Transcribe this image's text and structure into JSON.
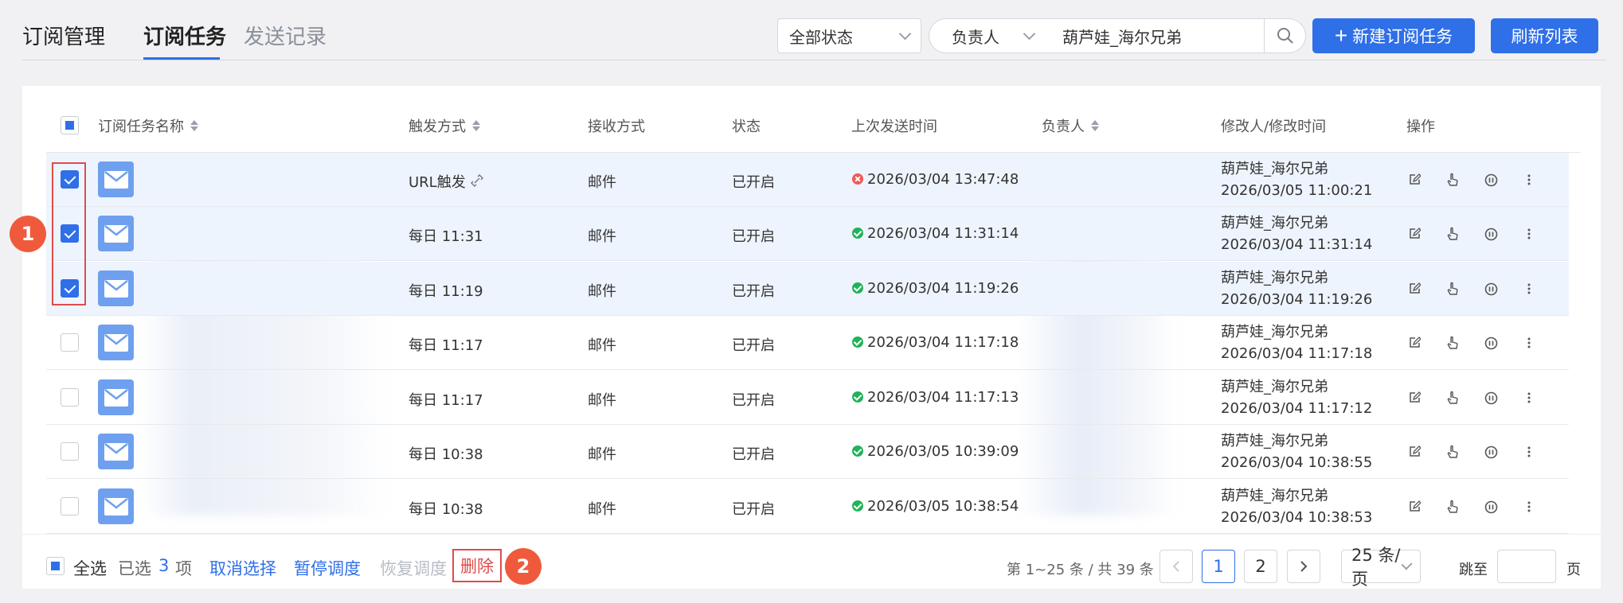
{
  "header": {
    "page_title": "订阅管理",
    "tabs": [
      {
        "label": "订阅任务",
        "active": true
      },
      {
        "label": "发送记录",
        "active": false
      }
    ],
    "status_filter": "全部状态",
    "owner_filter_label": "负责人",
    "owner_filter_value": "葫芦娃_海尔兄弟",
    "new_button": "新建订阅任务",
    "refresh_button": "刷新列表"
  },
  "table": {
    "columns": [
      "订阅任务名称",
      "触发方式",
      "接收方式",
      "状态",
      "上次发送时间",
      "负责人",
      "修改人/修改时间",
      "操作"
    ],
    "rows": [
      {
        "checked": true,
        "trigger": "URL触发",
        "trigger_link": true,
        "receive": "邮件",
        "status": "已开启",
        "last_status": "error",
        "last_sent": "2026/03/04 13:47:48",
        "modifier": "葫芦娃_海尔兄弟",
        "modified_at": "2026/03/05 11:00:21"
      },
      {
        "checked": true,
        "trigger": "每日 11:31",
        "receive": "邮件",
        "status": "已开启",
        "last_status": "success",
        "last_sent": "2026/03/04 11:31:14",
        "modifier": "葫芦娃_海尔兄弟",
        "modified_at": "2026/03/04 11:31:14"
      },
      {
        "checked": true,
        "trigger": "每日 11:19",
        "receive": "邮件",
        "status": "已开启",
        "last_status": "success",
        "last_sent": "2026/03/04 11:19:26",
        "modifier": "葫芦娃_海尔兄弟",
        "modified_at": "2026/03/04 11:19:26"
      },
      {
        "checked": false,
        "trigger": "每日 11:17",
        "receive": "邮件",
        "status": "已开启",
        "last_status": "success",
        "last_sent": "2026/03/04 11:17:18",
        "modifier": "葫芦娃_海尔兄弟",
        "modified_at": "2026/03/04 11:17:18"
      },
      {
        "checked": false,
        "trigger": "每日 11:17",
        "receive": "邮件",
        "status": "已开启",
        "last_status": "success",
        "last_sent": "2026/03/04 11:17:13",
        "modifier": "葫芦娃_海尔兄弟",
        "modified_at": "2026/03/04 11:17:12"
      },
      {
        "checked": false,
        "trigger": "每日 10:38",
        "receive": "邮件",
        "status": "已开启",
        "last_status": "success",
        "last_sent": "2026/03/05 10:39:09",
        "modifier": "葫芦娃_海尔兄弟",
        "modified_at": "2026/03/04 10:38:55"
      },
      {
        "checked": false,
        "trigger": "每日 10:38",
        "receive": "邮件",
        "status": "已开启",
        "last_status": "success",
        "last_sent": "2026/03/05 10:38:54",
        "modifier": "葫芦娃_海尔兄弟",
        "modified_at": "2026/03/04 10:38:53"
      }
    ],
    "row_action_icons": [
      "edit-icon",
      "send-icon",
      "pause-icon",
      "more-icon"
    ]
  },
  "footer": {
    "select_all": "全选",
    "selected_prefix": "已选",
    "selected_count": "3",
    "selected_suffix": "项",
    "cancel_selection": "取消选择",
    "pause_schedule": "暂停调度",
    "resume_schedule": "恢复调度",
    "delete": "删除",
    "range_text": "第 1~25 条 / 共 39 条",
    "pages": [
      "1",
      "2"
    ],
    "current_page": "1",
    "page_size": "25 条/页",
    "jump_prefix": "跳至",
    "jump_suffix": "页"
  },
  "annotations": [
    "1",
    "2"
  ],
  "colors": {
    "accent": "#2f6fe8",
    "danger": "#e04b4b",
    "success": "#22b25a",
    "badge": "#f05a3c"
  }
}
